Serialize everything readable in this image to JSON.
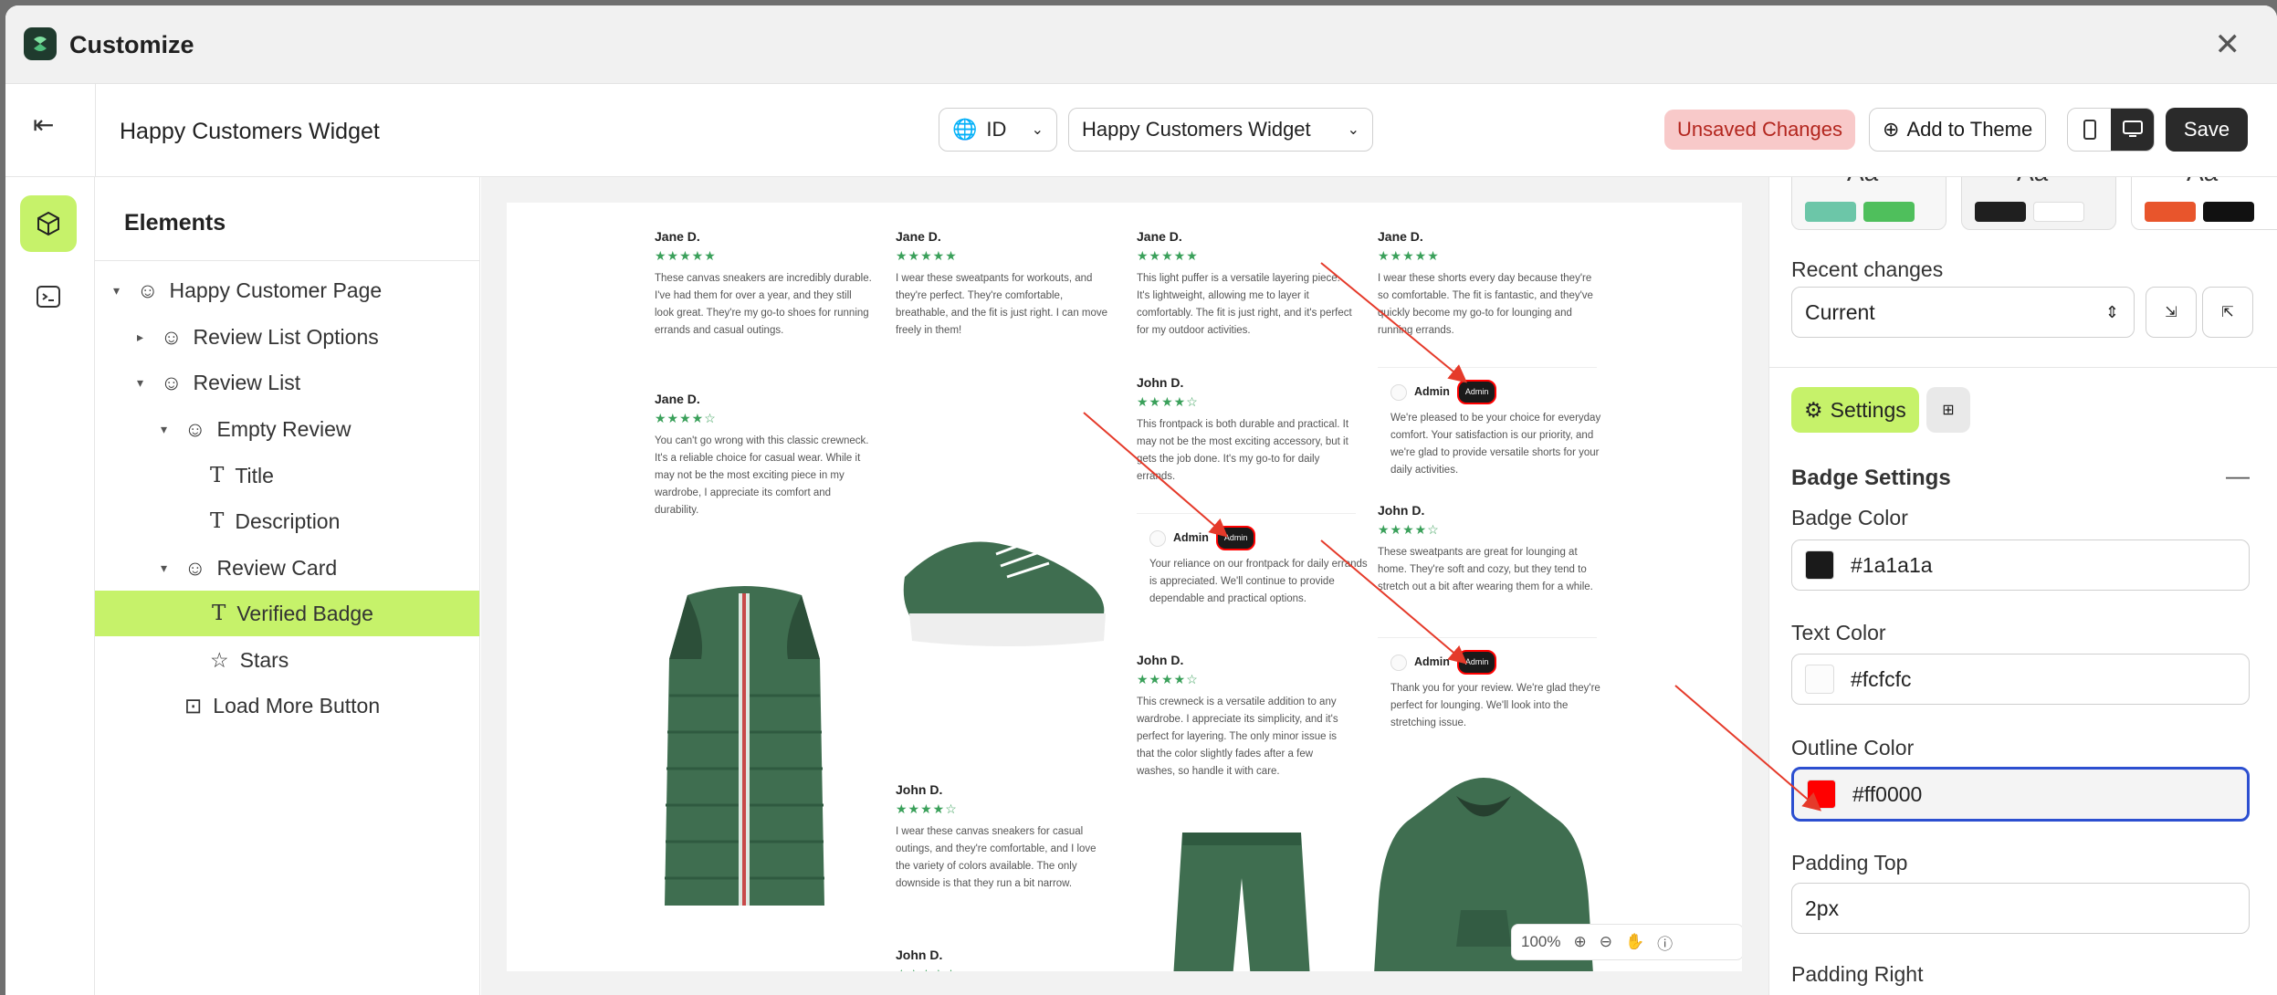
{
  "window": {
    "title": "Customize"
  },
  "toolbar": {
    "page_name": "Happy Customers Widget",
    "lang_label": "ID",
    "template_select": "Happy Customers Widget",
    "unsaved": "Unsaved Changes",
    "add_to_theme": "Add to Theme",
    "save": "Save"
  },
  "elements": {
    "heading": "Elements",
    "items": [
      "Happy Customer Page",
      "Review List Options",
      "Review List",
      "Empty Review",
      "Title",
      "Description",
      "Review Card",
      "Verified Badge",
      "Stars",
      "Load More Button"
    ]
  },
  "preview": {
    "reviews": [
      {
        "name": "Jane D.",
        "stars": "★★★★★",
        "text": "These canvas sneakers are incredibly durable. I've had them for over a year, and they still look great. They're my go-to shoes for running errands and casual outings."
      },
      {
        "name": "Jane D.",
        "stars": "★★★★☆",
        "text": "You can't go wrong with this classic crewneck. It's a reliable choice for casual wear. While it may not be the most exciting piece in my wardrobe, I appreciate its comfort and durability."
      },
      {
        "name": "Jane D.",
        "stars": "★★★★★",
        "text": "I wear these sweatpants for workouts, and they're perfect. They're comfortable, breathable, and the fit is just right. I can move freely in them!"
      },
      {
        "name": "John D.",
        "stars": "★★★★☆",
        "text": "I wear these canvas sneakers for casual outings, and they're comfortable, and I love the variety of colors available. The only downside is that they run a bit narrow."
      },
      {
        "name": "John D.",
        "stars": "★★★★★",
        "text": ""
      },
      {
        "name": "Jane D.",
        "stars": "★★★★★",
        "text": "This light puffer is a versatile layering piece. It's lightweight, allowing me to layer it comfortably. The fit is just right, and it's perfect for my outdoor activities."
      },
      {
        "name": "John D.",
        "stars": "★★★★☆",
        "text": "This frontpack is both durable and practical. It may not be the most exciting accessory, but it gets the job done. It's my go-to for daily errands."
      },
      {
        "name": "John D.",
        "stars": "★★★★☆",
        "text": "This crewneck is a versatile addition to any wardrobe. I appreciate its simplicity, and it's perfect for layering. The only minor issue is that the color slightly fades after a few washes, so handle it with care."
      },
      {
        "name": "Jane D.",
        "stars": "★★★★★",
        "text": "I wear these shorts every day because they're so comfortable. The fit is fantastic, and they've quickly become my go-to for lounging and running errands."
      },
      {
        "name": "John D.",
        "stars": "★★★★☆",
        "text": "These sweatpants are great for lounging at home. They're soft and cozy, but they tend to stretch out a bit after wearing them for a while."
      },
      {
        "name": "John D.",
        "stars": "★★★★☆",
        "text": ""
      }
    ],
    "admin_replies": [
      {
        "name": "Admin",
        "badge": "Admin",
        "text": "Your reliance on our frontpack for daily errands is appreciated. We'll continue to provide dependable and practical options."
      },
      {
        "name": "Admin",
        "badge": "Admin",
        "text": "We're pleased to be your choice for everyday comfort. Your satisfaction is our priority, and we're glad to provide versatile shorts for your daily activities."
      },
      {
        "name": "Admin",
        "badge": "Admin",
        "text": "Thank you for your review. We're glad they're perfect for lounging. We'll look into the stretching issue."
      }
    ],
    "zoom": "100%"
  },
  "settings": {
    "recent_changes_label": "Recent changes",
    "recent_changes_value": "Current",
    "settings_tab": "Settings",
    "section_title": "Badge Settings",
    "badge_color_label": "Badge Color",
    "badge_color": "#1a1a1a",
    "text_color_label": "Text Color",
    "text_color": "#fcfcfc",
    "outline_color_label": "Outline Color",
    "outline_color": "#ff0000",
    "padding_top_label": "Padding Top",
    "padding_top": "2px",
    "padding_right_label": "Padding Right"
  },
  "theme_swatches": [
    {
      "a": "#6cc6a8",
      "b": "#4fbf5c"
    },
    {
      "a": "#1f1f1f",
      "b": "#ffffff"
    },
    {
      "a": "#e8552c",
      "b": "#111111"
    }
  ],
  "colors": {
    "accent": "#c6f26a",
    "annotation": "#e53a2a",
    "focus": "#2c4fd0"
  }
}
